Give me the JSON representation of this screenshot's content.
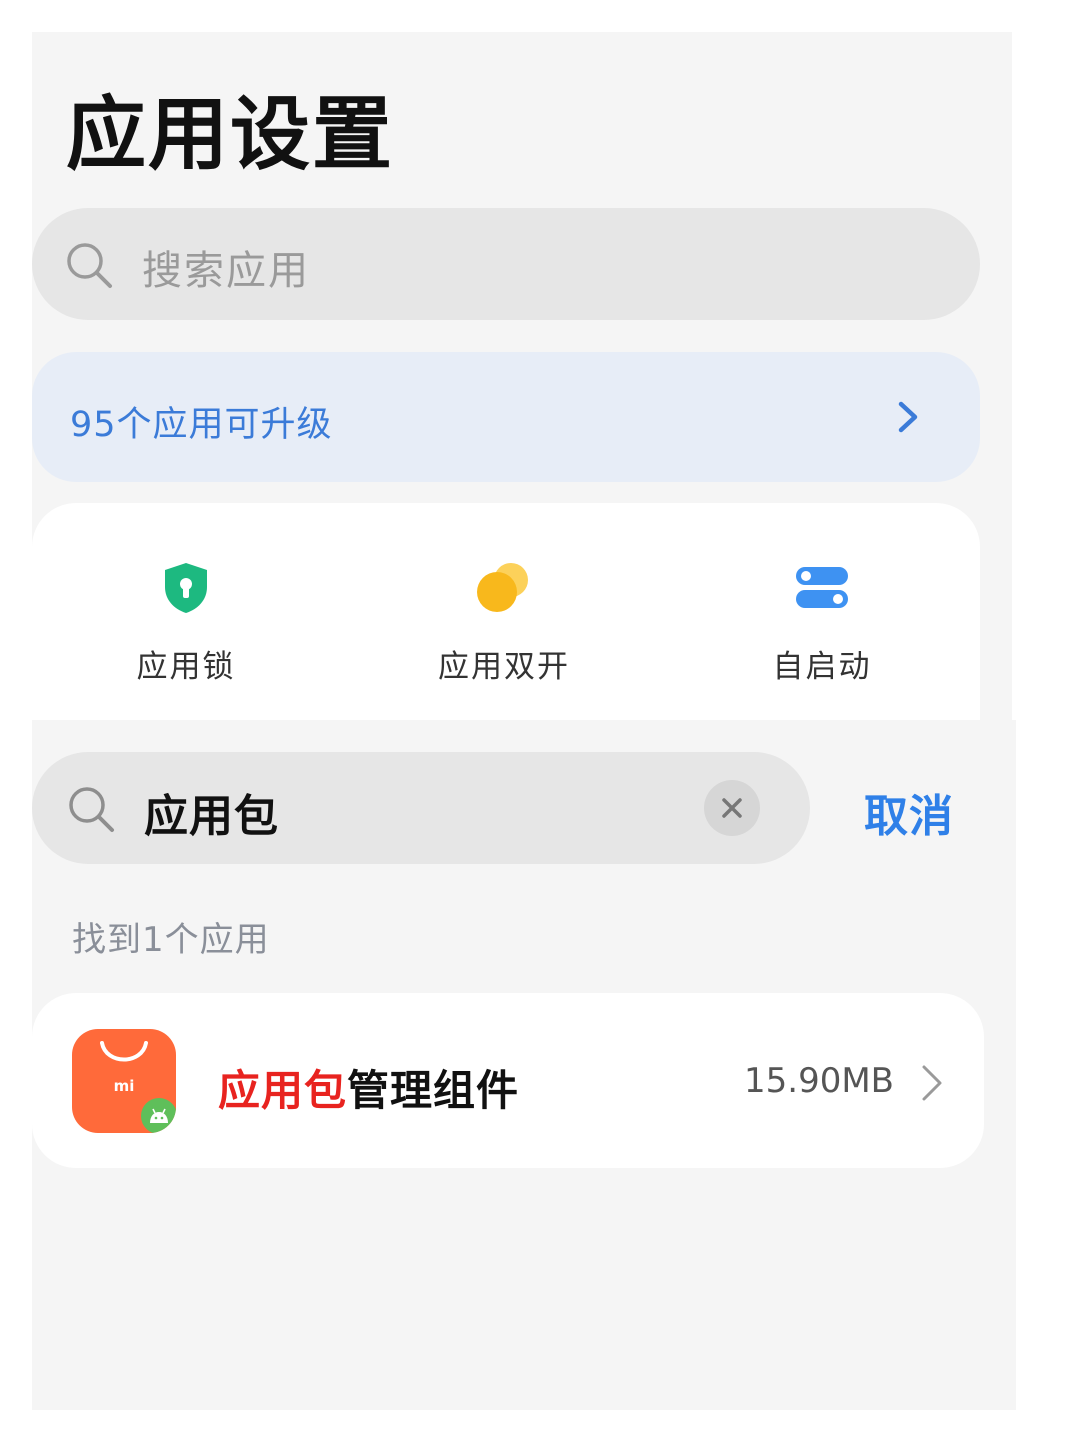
{
  "header": {
    "title": "应用设置"
  },
  "search": {
    "placeholder": "搜索应用"
  },
  "upgrade_banner": {
    "label": "95个应用可升级",
    "icon": "chevron-right-icon",
    "color": "#3b7bd8"
  },
  "shortcuts": [
    {
      "label": "应用锁",
      "icon": "shield-lock-icon",
      "color": "#1db980"
    },
    {
      "label": "应用双开",
      "icon": "dual-circles-icon",
      "color": "#f8b81c"
    },
    {
      "label": "自启动",
      "icon": "toggle-switches-icon",
      "color": "#3e92f2"
    }
  ],
  "active_search": {
    "value": "应用包",
    "clear_icon": "close-icon",
    "cancel_label": "取消",
    "cancel_color": "#2f80e8"
  },
  "results": {
    "count_label": "找到1个应用",
    "items": [
      {
        "name_highlight": "应用包",
        "name_rest": "管理组件",
        "size": "15.90MB",
        "icon": "mi-app-store-icon",
        "icon_text": "mi",
        "icon_color": "#ff6a3a",
        "highlight_color": "#e8231f"
      }
    ]
  }
}
